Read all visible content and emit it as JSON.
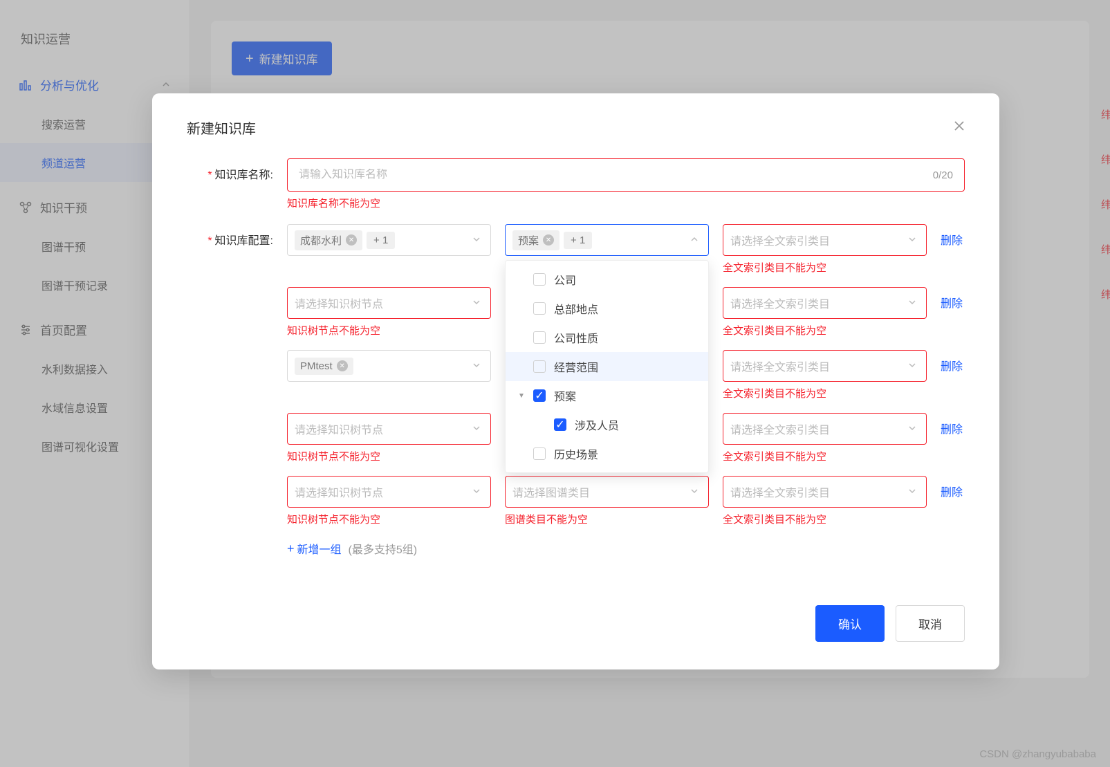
{
  "sidebar": {
    "header": "知识运营",
    "groups": [
      {
        "icon": "chart-icon",
        "title": "分析与优化",
        "active": true,
        "expanded": true,
        "items": [
          {
            "label": "搜索运营",
            "active": false
          },
          {
            "label": "频道运营",
            "active": true
          }
        ]
      },
      {
        "icon": "intervene-icon",
        "title": "知识干预",
        "active": false,
        "expanded": true,
        "items": [
          {
            "label": "图谱干预",
            "active": false
          },
          {
            "label": "图谱干预记录",
            "active": false
          }
        ]
      },
      {
        "icon": "settings-icon",
        "title": "首页配置",
        "active": false,
        "expanded": true,
        "items": [
          {
            "label": "水利数据接入",
            "active": false
          },
          {
            "label": "水域信息设置",
            "active": false
          },
          {
            "label": "图谱可视化设置",
            "active": false
          }
        ]
      }
    ]
  },
  "bg_main": {
    "new_button": "新建知识库"
  },
  "modal": {
    "title": "新建知识库",
    "name_field": {
      "label": "知识库名称:",
      "placeholder": "请输入知识库名称",
      "counter": "0/20",
      "error": "知识库名称不能为空"
    },
    "config_field": {
      "label": "知识库配置:",
      "placeholders": {
        "tree": "请选择知识树节点",
        "graph": "请选择图谱类目",
        "full": "请选择全文索引类目"
      },
      "errors": {
        "tree": "知识树节点不能为空",
        "graph": "图谱类目不能为空",
        "full": "全文索引类目不能为空"
      },
      "rows": [
        {
          "tree": {
            "tags": [
              "成都水利"
            ],
            "more": "+ 1"
          },
          "graph": {
            "tags": [
              "预案"
            ],
            "more": "+ 1",
            "open": true
          },
          "full": {
            "error": true
          },
          "delete": "删除"
        },
        {
          "tree": {
            "error": true
          },
          "graph": null,
          "full": {
            "error": true
          },
          "delete": "删除"
        },
        {
          "tree": {
            "tags": [
              "PMtest"
            ]
          },
          "graph": null,
          "full": {
            "error": true
          },
          "delete": "删除"
        },
        {
          "tree": {
            "error": true
          },
          "graph": null,
          "full": {
            "error": true
          },
          "delete": "删除"
        },
        {
          "tree": {
            "error": true
          },
          "graph": {
            "error": true
          },
          "full": {
            "error": true
          },
          "delete": "删除"
        }
      ],
      "add_link": "新增一组",
      "add_hint": "(最多支持5组)"
    },
    "dropdown": {
      "items": [
        {
          "label": "公司",
          "checked": false,
          "expandable": false
        },
        {
          "label": "总部地点",
          "checked": false,
          "expandable": false
        },
        {
          "label": "公司性质",
          "checked": false,
          "expandable": false
        },
        {
          "label": "经营范围",
          "checked": false,
          "expandable": false,
          "hovered": true
        },
        {
          "label": "预案",
          "checked": true,
          "expandable": true,
          "expanded": true
        },
        {
          "label": "涉及人员",
          "checked": true,
          "indent": true
        },
        {
          "label": "历史场景",
          "checked": false,
          "expandable": false
        }
      ]
    },
    "footer": {
      "confirm": "确认",
      "cancel": "取消"
    }
  },
  "watermark": "CSDN @zhangyubababa"
}
